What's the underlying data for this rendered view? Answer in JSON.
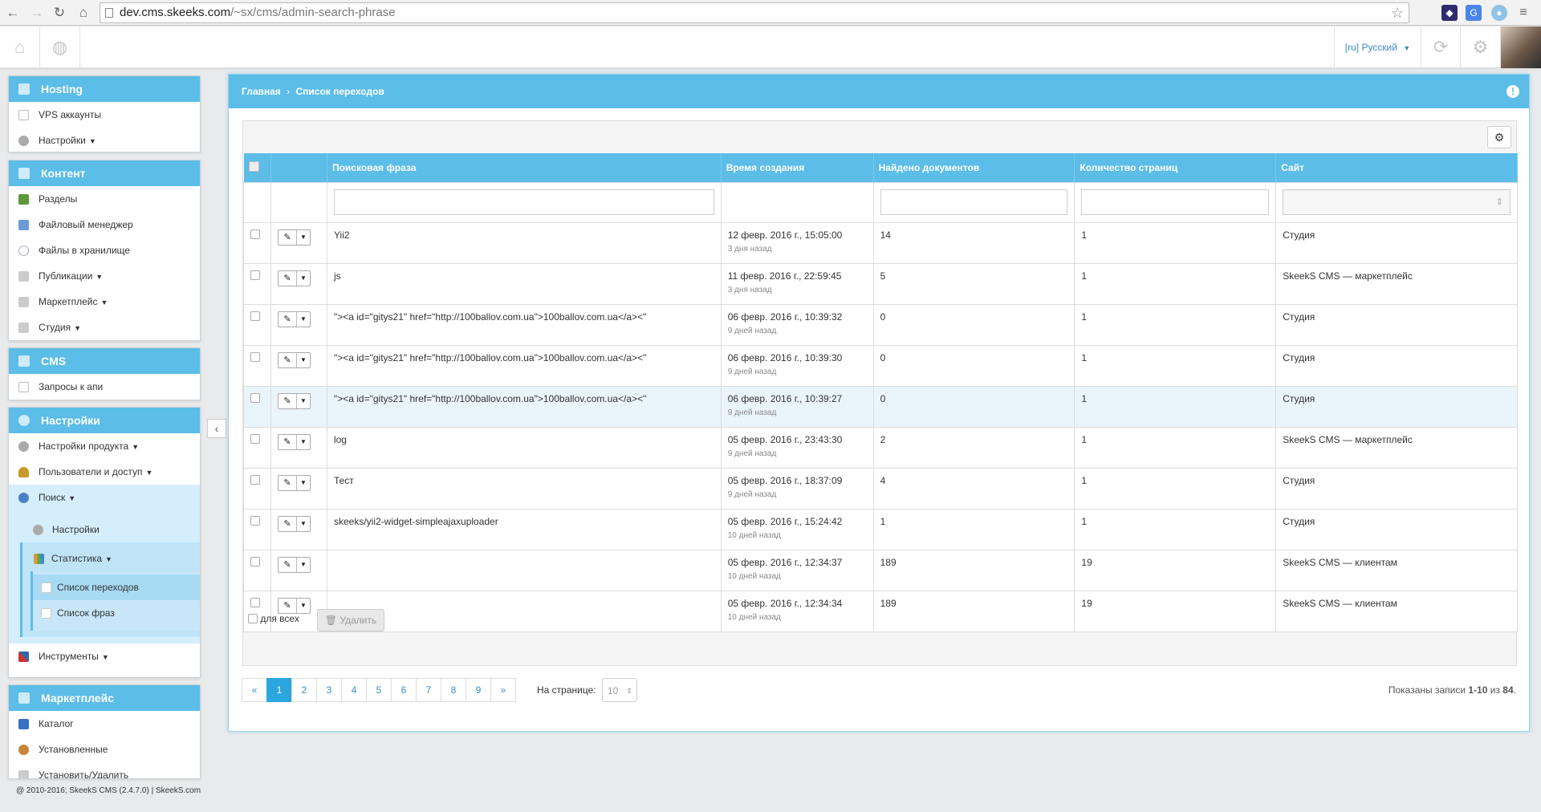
{
  "browser": {
    "url_host": "dev.cms.skeeks.com",
    "url_path": "/~sx/cms/admin-search-phrase"
  },
  "topbar": {
    "language": "[ru] Русский"
  },
  "sidebar": {
    "hosting": {
      "title": "Hosting",
      "items": [
        "VPS аккаунты",
        "Настройки"
      ]
    },
    "content": {
      "title": "Контент",
      "items": [
        "Разделы",
        "Файловый менеджер",
        "Файлы в хранилище",
        "Публикации",
        "Маркетплейс",
        "Студия"
      ]
    },
    "cms": {
      "title": "CMS",
      "items": [
        "Запросы к апи"
      ]
    },
    "settings": {
      "title": "Настройки",
      "items": [
        "Настройки продукта",
        "Пользователи и доступ",
        "Поиск"
      ],
      "search_sub": [
        "Настройки",
        "Статистика"
      ],
      "stats_sub": [
        "Список переходов",
        "Список фраз"
      ],
      "tools": "Инструменты"
    },
    "marketplace": {
      "title": "Маркетплейс",
      "items": [
        "Каталог",
        "Установленные",
        "Установить/Удалить"
      ]
    }
  },
  "breadcrumb": {
    "home": "Главная",
    "separator": "›",
    "current": "Список переходов"
  },
  "table": {
    "columns": [
      "Поисковая фраза",
      "Время создания",
      "Найдено документов",
      "Количество страниц",
      "Сайт"
    ],
    "rows": [
      {
        "phrase": "Yii2",
        "time": "12 февр. 2016 г., 15:05:00",
        "ago": "3 дня назад",
        "found": "14",
        "pages": "1",
        "site": "Студия"
      },
      {
        "phrase": "js",
        "time": "11 февр. 2016 г., 22:59:45",
        "ago": "3 дня назад",
        "found": "5",
        "pages": "1",
        "site": "SkeekS CMS — маркетплейс"
      },
      {
        "phrase": "\"><a id=\"gitys21\" href=\"http://100ballov.com.ua\">100ballov.com.ua</a><\"",
        "time": "06 февр. 2016 г., 10:39:32",
        "ago": "9 дней назад",
        "found": "0",
        "pages": "1",
        "site": "Студия"
      },
      {
        "phrase": "\"><a id=\"gitys21\" href=\"http://100ballov.com.ua\">100ballov.com.ua</a><\"",
        "time": "06 февр. 2016 г., 10:39:30",
        "ago": "9 дней назад",
        "found": "0",
        "pages": "1",
        "site": "Студия"
      },
      {
        "phrase": "\"><a id=\"gitys21\" href=\"http://100ballov.com.ua\">100ballov.com.ua</a><\"",
        "time": "06 февр. 2016 г., 10:39:27",
        "ago": "9 дней назад",
        "found": "0",
        "pages": "1",
        "site": "Студия"
      },
      {
        "phrase": "log",
        "time": "05 февр. 2016 г., 23:43:30",
        "ago": "9 дней назад",
        "found": "2",
        "pages": "1",
        "site": "SkeekS CMS — маркетплейс"
      },
      {
        "phrase": "Тест",
        "time": "05 февр. 2016 г., 18:37:09",
        "ago": "9 дней назад",
        "found": "4",
        "pages": "1",
        "site": "Студия"
      },
      {
        "phrase": "skeeks/yii2-widget-simpleajaxuploader",
        "time": "05 февр. 2016 г., 15:24:42",
        "ago": "10 дней назад",
        "found": "1",
        "pages": "1",
        "site": "Студия"
      },
      {
        "phrase": "",
        "time": "05 февр. 2016 г., 12:34:37",
        "ago": "10 дней назад",
        "found": "189",
        "pages": "19",
        "site": "SkeekS CMS — клиентам"
      },
      {
        "phrase": "",
        "time": "05 февр. 2016 г., 12:34:34",
        "ago": "10 дней назад",
        "found": "189",
        "pages": "19",
        "site": "SkeekS CMS — клиентам"
      }
    ],
    "for_all": "для всех",
    "delete": "Удалить"
  },
  "pagination": {
    "prev": "«",
    "next": "»",
    "pages": [
      "1",
      "2",
      "3",
      "4",
      "5",
      "6",
      "7",
      "8",
      "9"
    ],
    "per_page_label": "На странице:",
    "per_page_value": "10"
  },
  "summary": {
    "prefix": "Показаны записи ",
    "range": "1-10",
    "mid": " из ",
    "total": "84",
    "suffix": "."
  },
  "footer": {
    "copyright": "@ 2010-2016; SkeekS CMS (2.4.7.0) | SkeekS.com"
  },
  "colors": {
    "accent": "#5bbde8",
    "active_page": "#2ba6de"
  }
}
